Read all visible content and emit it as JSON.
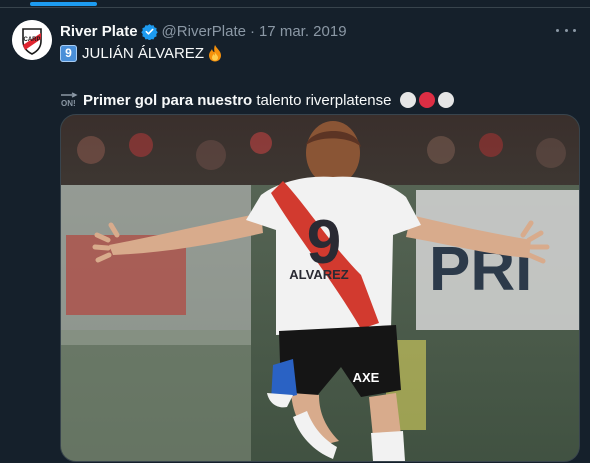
{
  "tweet": {
    "display_name": "River Plate",
    "handle": "@RiverPlate",
    "separator": "·",
    "date": "17 mar. 2019",
    "line1": {
      "keycap": "9",
      "text": "JULIÁN ÁLVAREZ"
    },
    "line2": {
      "bold": "Primer gol para nuestro",
      "rest": " talento riverplatense"
    },
    "media": {
      "jersey_number": "9",
      "jersey_name": "ALVAREZ",
      "shorts_brand": "AXE",
      "banner_text": "PRI"
    }
  },
  "icons": {
    "avatar": "river-plate-crest",
    "verified": "verified-badge-icon",
    "more": "more-options-icon",
    "keycap": "keycap-nine-emoji",
    "fire": "fire-emoji",
    "on": "on-arrow-emoji",
    "circles": [
      "white-circle",
      "red-circle",
      "white-circle"
    ]
  },
  "colors": {
    "background": "#15202b",
    "accent": "#1d9bf0",
    "secondary_text": "#8b98a5",
    "club_red": "#dd2e44"
  }
}
